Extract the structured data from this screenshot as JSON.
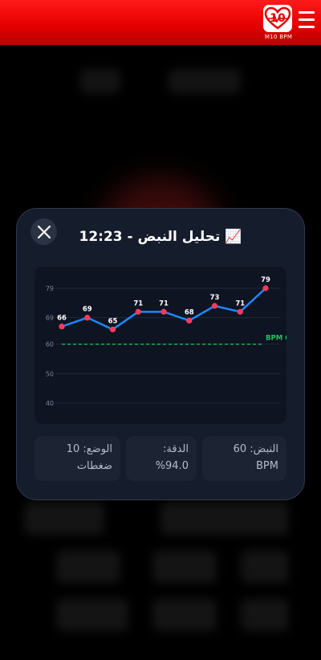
{
  "header": {
    "logo_number": "10",
    "logo_caption": "M10 BPM"
  },
  "modal": {
    "title_icon": "📈",
    "title": "تحليل النبض - 12:23"
  },
  "chart_data": {
    "type": "line",
    "y_ticks": [
      40,
      50,
      60,
      69,
      79
    ],
    "values": [
      66,
      69,
      65,
      71,
      71,
      68,
      73,
      71,
      79
    ],
    "data_labels": [
      "66",
      "69",
      "65",
      "71",
      "71",
      "68",
      "73",
      "71",
      "79"
    ],
    "reference_value": 60,
    "reference_label": "BPM 6",
    "ylim": [
      35,
      81
    ],
    "grid": true,
    "line_color": "#1e88ff",
    "point_color": "#ff3b5c",
    "reference_color": "#22c55e"
  },
  "stats": {
    "pulse": {
      "label": "النبض: 60",
      "value": "BPM"
    },
    "accuracy": {
      "label": "الدقة:",
      "value": "%94.0"
    },
    "mode": {
      "label": "الوضع: 10",
      "value": "ضغطات"
    }
  }
}
